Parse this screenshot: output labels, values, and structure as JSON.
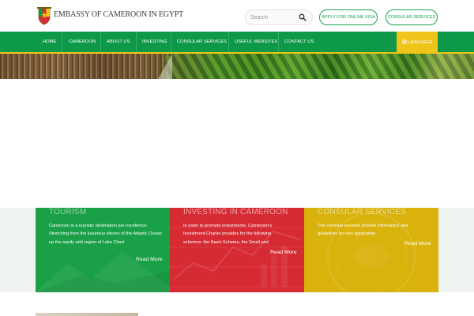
{
  "header": {
    "logo_icon": "cameroon-coat-of-arms-icon",
    "site_title": "EMBASSY OF CAMEROON IN EGYPT",
    "search_placeholder": "Search",
    "search_icon": "search-icon",
    "apply_visa_label": "APPLY FOR ONLINE VISA",
    "consular_services_label": "CONSULAR SERVICES",
    "accent_color": "#17a34a"
  },
  "nav": {
    "items": [
      {
        "label": "HOME"
      },
      {
        "label": "CAMEROON"
      },
      {
        "label": "ABOUT US"
      },
      {
        "label": "INVESTING"
      },
      {
        "label": "CONSULAR SERVICES"
      },
      {
        "label": "USEFUL WEBSITES"
      },
      {
        "label": "CONTACT US"
      }
    ],
    "language_label": "LANGUAGE",
    "language_icon": "globe-icon",
    "bar_color": "#0d9948",
    "language_color": "#f0c419"
  },
  "cards": [
    {
      "title": "TOURISM",
      "body": "Cameroon is a touristic destination par excellence. Stretching from the luxurious shores of the Atlantic Ocean up the sandy arid region of Lake Chad.",
      "read_more": "Read More",
      "color": "#1aa047"
    },
    {
      "title": "INVESTING IN CAMEROON",
      "body": "In order to promote investments, Cameroon's Investment Charter provides for the following schemes: the Basic Scheme, the Small and",
      "read_more": "Read More",
      "color": "#d62b33"
    },
    {
      "title": "CONSULAR SERVICES",
      "body": "The consular services provide information and guidelines for visa application.",
      "read_more": "Read More",
      "color": "#d9b20c"
    }
  ]
}
